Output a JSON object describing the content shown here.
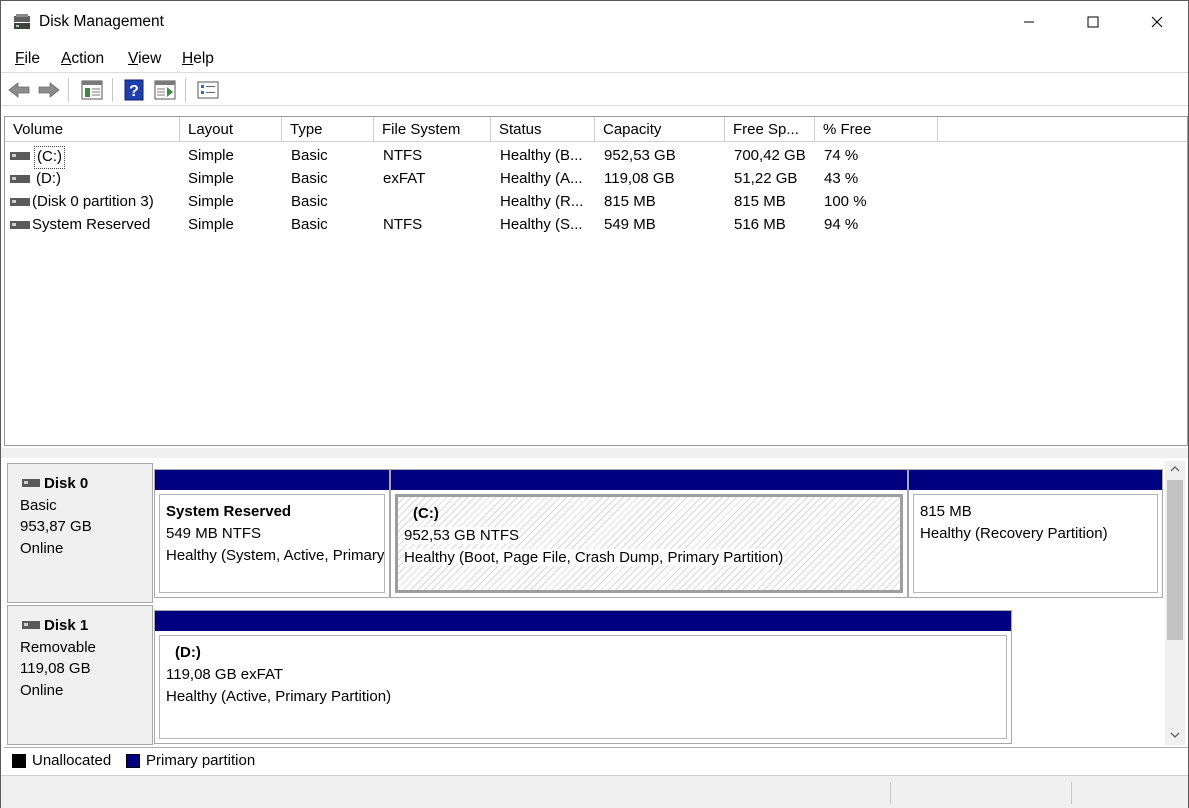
{
  "window": {
    "title": "Disk Management",
    "minimize_icon": "minimize-icon",
    "maximize_icon": "maximize-icon",
    "close_icon": "close-icon"
  },
  "menu": [
    {
      "label_u": "F",
      "label_rest": "ile"
    },
    {
      "label_u": "A",
      "label_rest": "ction"
    },
    {
      "label_u": "V",
      "label_rest": "iew"
    },
    {
      "label_u": "H",
      "label_rest": "elp"
    }
  ],
  "toolbar": {
    "icons": [
      "back-arrow-icon",
      "forward-arrow-icon",
      "properties-panel-icon",
      "help-icon",
      "console-tree-icon",
      "checklist-icon"
    ]
  },
  "volume_list": {
    "columns": [
      "Volume",
      "Layout",
      "Type",
      "File System",
      "Status",
      "Capacity",
      "Free Sp...",
      "% Free"
    ],
    "rows": [
      {
        "volume": "(C:)",
        "layout": "Simple",
        "type": "Basic",
        "fs": "NTFS",
        "status": "Healthy (B...",
        "capacity": "952,53 GB",
        "free": "700,42 GB",
        "pct": "74 %"
      },
      {
        "volume": "(D:)",
        "layout": "Simple",
        "type": "Basic",
        "fs": "exFAT",
        "status": "Healthy (A...",
        "capacity": "119,08 GB",
        "free": "51,22 GB",
        "pct": "43 %"
      },
      {
        "volume": "(Disk 0 partition 3)",
        "layout": "Simple",
        "type": "Basic",
        "fs": "",
        "status": "Healthy (R...",
        "capacity": "815 MB",
        "free": "815 MB",
        "pct": "100 %"
      },
      {
        "volume": "System Reserved",
        "layout": "Simple",
        "type": "Basic",
        "fs": "NTFS",
        "status": "Healthy (S...",
        "capacity": "549 MB",
        "free": "516 MB",
        "pct": "94 %"
      }
    ]
  },
  "disks": [
    {
      "name": "Disk 0",
      "kind": "Basic",
      "size": "953,87 GB",
      "state": "Online",
      "partitions": [
        {
          "name": "System Reserved",
          "line2": "549 MB NTFS",
          "line3": "Healthy (System, Active, Primary Partition)"
        },
        {
          "name": "(C:)",
          "line2": "952,53 GB NTFS",
          "line3": "Healthy (Boot, Page File, Crash Dump, Primary Partition)"
        },
        {
          "name": "",
          "line2": "815 MB",
          "line3": "Healthy (Recovery Partition)"
        }
      ]
    },
    {
      "name": "Disk 1",
      "kind": "Removable",
      "size": "119,08 GB",
      "state": "Online",
      "partitions": [
        {
          "name": "(D:)",
          "line2": "119,08 GB exFAT",
          "line3": "Healthy (Active, Primary Partition)"
        }
      ]
    }
  ],
  "legend": [
    {
      "label": "Unallocated",
      "color": "#000000"
    },
    {
      "label": "Primary partition",
      "color": "#000080"
    }
  ],
  "colors": {
    "primary_partition_bar": "#000080",
    "panel_bg": "#f0f0f0"
  }
}
